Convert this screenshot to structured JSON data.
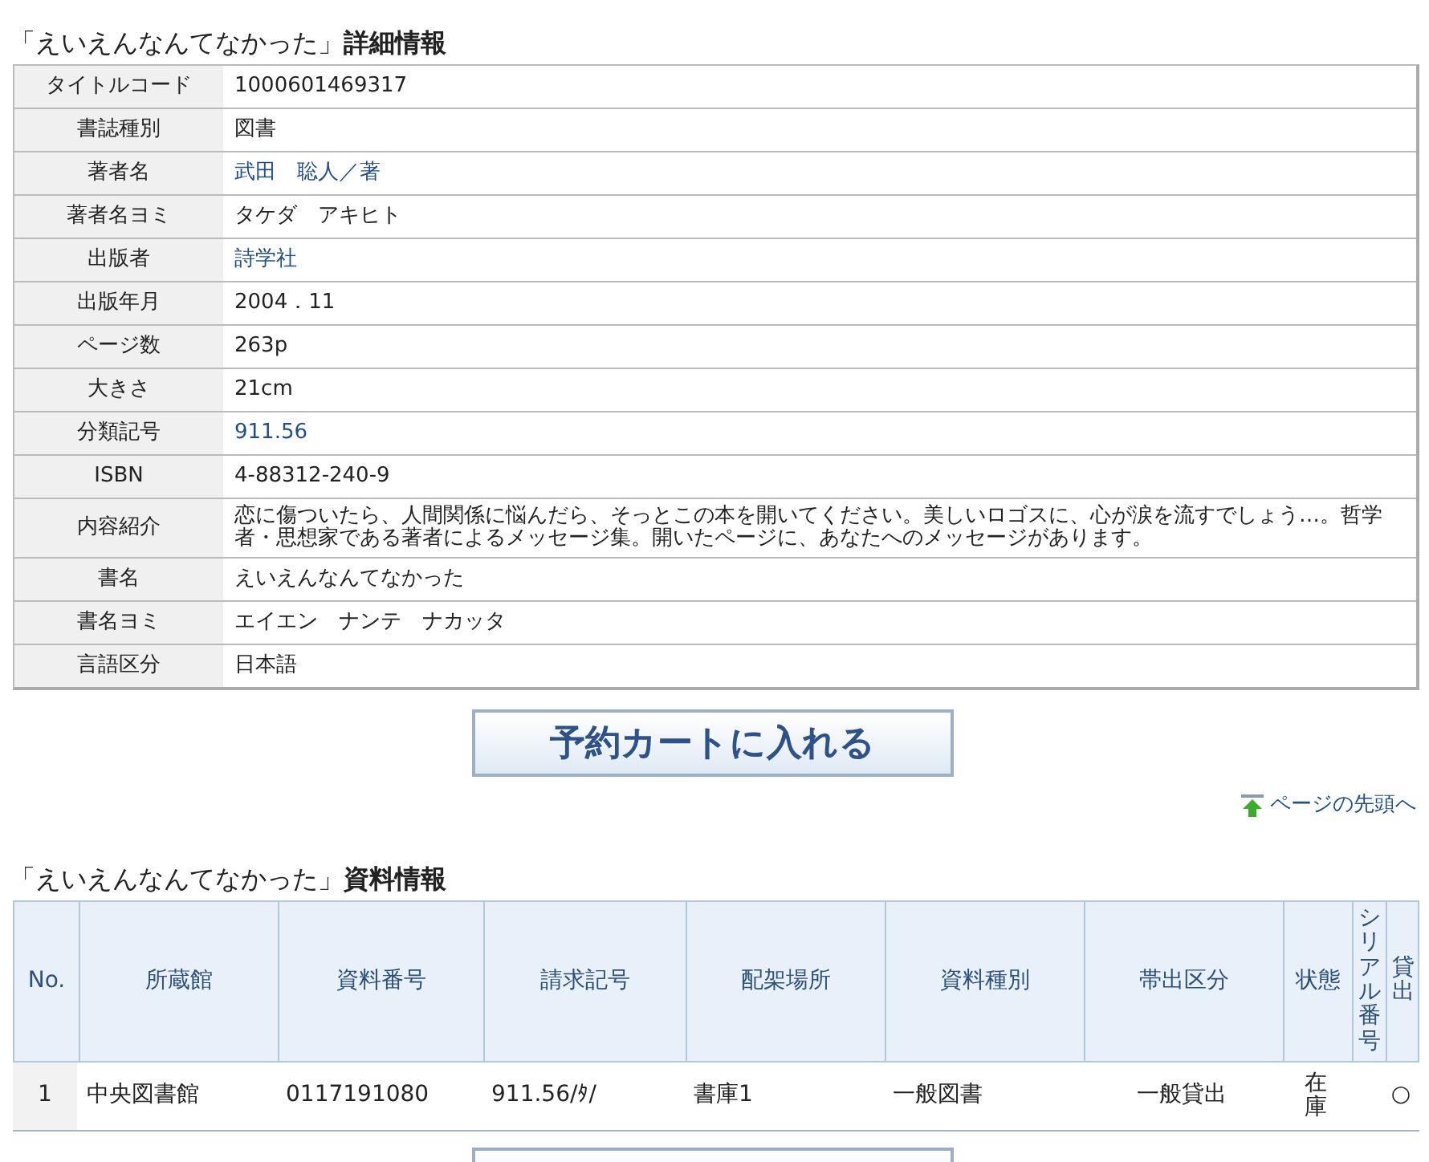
{
  "detail_heading": "「えいえんなんてなかった」**詳細情報**",
  "details": [
    {
      "label": "タイトルコード",
      "value": "1000601469317",
      "link": false
    },
    {
      "label": "書誌種別",
      "value": "図書",
      "link": false
    },
    {
      "label": "著者名",
      "value": "武田　聡人／著",
      "link": true
    },
    {
      "label": "著者名ヨミ",
      "value": "タケダ　アキヒト",
      "link": false
    },
    {
      "label": "出版者",
      "value": "詩学社",
      "link": true
    },
    {
      "label": "出版年月",
      "value": "2004．11",
      "link": false
    },
    {
      "label": "ページ数",
      "value": "263p",
      "link": false
    },
    {
      "label": "大きさ",
      "value": "21cm",
      "link": false
    },
    {
      "label": "分類記号",
      "value": "911.56",
      "link": true
    },
    {
      "label": "ISBN",
      "value": "4-88312-240-9",
      "link": false
    },
    {
      "label": "内容紹介",
      "value": "恋に傷ついたら、人間関係に悩んだら、そっとこの本を開いてください。美しいロゴスに、心が涙を流すでしょう…。哲学者・思想家である著者によるメッセージ集。開いたページに、あなたへのメッセージがあります。",
      "link": false
    },
    {
      "label": "書名",
      "value": "えいえんなんてなかった",
      "link": false
    },
    {
      "label": "書名ヨミ",
      "value": "エイエン　ナンテ　ナカッタ",
      "link": false
    },
    {
      "label": "言語区分",
      "value": "日本語",
      "link": false
    }
  ],
  "reserve_button": "予約カートに入れる",
  "top_link": "ページの先頭へ",
  "items_heading": "「えいえんなんてなかった」**資料情報**",
  "items_table": {
    "columns": [
      {
        "label": "No.",
        "kind": "normal"
      },
      {
        "label": "所蔵館",
        "kind": "normal"
      },
      {
        "label": "資料番号",
        "kind": "normal"
      },
      {
        "label": "請求記号",
        "kind": "normal"
      },
      {
        "label": "配架場所",
        "kind": "normal"
      },
      {
        "label": "資料種別",
        "kind": "normal"
      },
      {
        "label": "帯出区分",
        "kind": "normal"
      },
      {
        "label": "状態",
        "kind": "normal"
      },
      {
        "label": "シリアル番号",
        "kind": "vertical"
      },
      {
        "label": "貸出",
        "kind": "vertical"
      }
    ],
    "rows": [
      [
        "1",
        "中央図書館",
        "0117191080",
        "911.56/ﾀ/",
        "書庫1",
        "一般図書",
        "一般貸出",
        "在庫",
        "",
        "○"
      ]
    ]
  }
}
